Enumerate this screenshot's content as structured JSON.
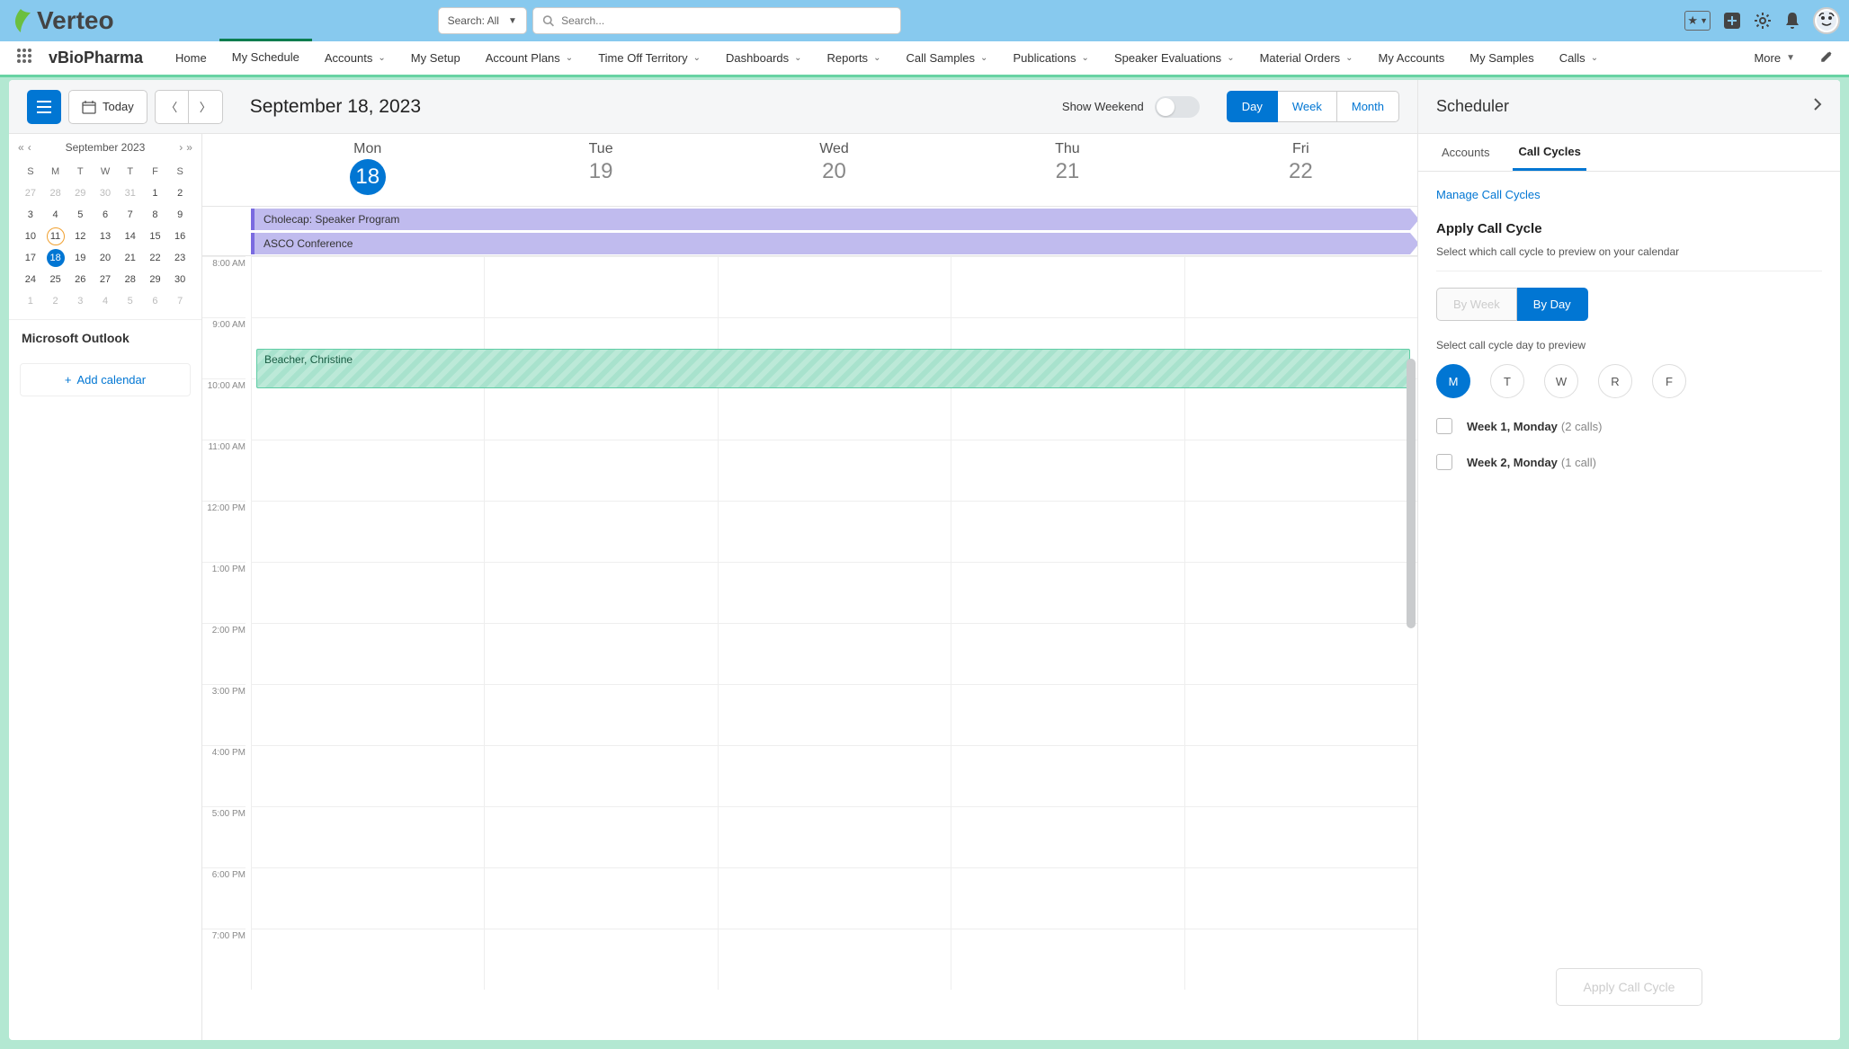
{
  "brand": "Verteo",
  "header": {
    "search_mode": "Search: All",
    "search_placeholder": "Search...",
    "app_name": "vBioPharma",
    "more_label": "More"
  },
  "nav": {
    "tabs": [
      {
        "label": "Home",
        "dropdown": false,
        "active": false
      },
      {
        "label": "My Schedule",
        "dropdown": false,
        "active": true
      },
      {
        "label": "Accounts",
        "dropdown": true,
        "active": false
      },
      {
        "label": "My Setup",
        "dropdown": false,
        "active": false
      },
      {
        "label": "Account Plans",
        "dropdown": true,
        "active": false
      },
      {
        "label": "Time Off Territory",
        "dropdown": true,
        "active": false
      },
      {
        "label": "Dashboards",
        "dropdown": true,
        "active": false
      },
      {
        "label": "Reports",
        "dropdown": true,
        "active": false
      },
      {
        "label": "Call Samples",
        "dropdown": true,
        "active": false
      },
      {
        "label": "Publications",
        "dropdown": true,
        "active": false
      },
      {
        "label": "Speaker Evaluations",
        "dropdown": true,
        "active": false
      },
      {
        "label": "Material Orders",
        "dropdown": true,
        "active": false
      },
      {
        "label": "My Accounts",
        "dropdown": false,
        "active": false
      },
      {
        "label": "My Samples",
        "dropdown": false,
        "active": false
      },
      {
        "label": "Calls",
        "dropdown": true,
        "active": false
      }
    ]
  },
  "toolbar": {
    "today": "Today",
    "title": "September 18, 2023",
    "show_weekend": "Show Weekend",
    "views": [
      "Day",
      "Week",
      "Month"
    ],
    "active_view": "Day"
  },
  "minical": {
    "title": "September 2023",
    "dow": [
      "S",
      "M",
      "T",
      "W",
      "T",
      "F",
      "S"
    ],
    "weeks": [
      [
        {
          "n": "27",
          "out": true
        },
        {
          "n": "28",
          "out": true
        },
        {
          "n": "29",
          "out": true
        },
        {
          "n": "30",
          "out": true
        },
        {
          "n": "31",
          "out": true
        },
        {
          "n": "1"
        },
        {
          "n": "2"
        }
      ],
      [
        {
          "n": "3"
        },
        {
          "n": "4"
        },
        {
          "n": "5"
        },
        {
          "n": "6"
        },
        {
          "n": "7"
        },
        {
          "n": "8"
        },
        {
          "n": "9"
        }
      ],
      [
        {
          "n": "10"
        },
        {
          "n": "11",
          "outline": true
        },
        {
          "n": "12"
        },
        {
          "n": "13"
        },
        {
          "n": "14"
        },
        {
          "n": "15"
        },
        {
          "n": "16"
        }
      ],
      [
        {
          "n": "17"
        },
        {
          "n": "18",
          "today": true
        },
        {
          "n": "19"
        },
        {
          "n": "20"
        },
        {
          "n": "21"
        },
        {
          "n": "22"
        },
        {
          "n": "23"
        }
      ],
      [
        {
          "n": "24"
        },
        {
          "n": "25"
        },
        {
          "n": "26"
        },
        {
          "n": "27"
        },
        {
          "n": "28"
        },
        {
          "n": "29"
        },
        {
          "n": "30"
        }
      ],
      [
        {
          "n": "1",
          "out": true
        },
        {
          "n": "2",
          "out": true
        },
        {
          "n": "3",
          "out": true
        },
        {
          "n": "4",
          "out": true
        },
        {
          "n": "5",
          "out": true
        },
        {
          "n": "6",
          "out": true
        },
        {
          "n": "7",
          "out": true
        }
      ]
    ],
    "outlook_label": "Microsoft Outlook",
    "add_calendar": "Add calendar"
  },
  "weekview": {
    "days": [
      {
        "name": "Mon",
        "num": "18",
        "current": true
      },
      {
        "name": "Tue",
        "num": "19"
      },
      {
        "name": "Wed",
        "num": "20"
      },
      {
        "name": "Thu",
        "num": "21"
      },
      {
        "name": "Fri",
        "num": "22"
      }
    ],
    "allday_events": [
      "Cholecap: Speaker Program",
      "ASCO Conference"
    ],
    "timed_event": "Beacher, Christine",
    "hours": [
      "8:00 AM",
      "9:00 AM",
      "10:00 AM",
      "11:00 AM",
      "12:00 PM",
      "1:00 PM",
      "2:00 PM",
      "3:00 PM",
      "4:00 PM",
      "5:00 PM",
      "6:00 PM",
      "7:00 PM"
    ]
  },
  "scheduler": {
    "title": "Scheduler",
    "tabs": [
      "Accounts",
      "Call Cycles"
    ],
    "active_tab": "Call Cycles",
    "manage_link": "Manage Call Cycles",
    "apply_heading": "Apply Call Cycle",
    "apply_hint": "Select which call cycle to preview on your calendar",
    "mode": {
      "by_week": "By Week",
      "by_day": "By Day"
    },
    "day_hint": "Select call cycle day to preview",
    "dows": [
      "M",
      "T",
      "W",
      "R",
      "F"
    ],
    "active_dow": "M",
    "weeks": [
      {
        "label": "Week 1, Monday",
        "count": "(2 calls)"
      },
      {
        "label": "Week 2, Monday",
        "count": "(1 call)"
      }
    ],
    "apply_btn": "Apply Call Cycle"
  }
}
